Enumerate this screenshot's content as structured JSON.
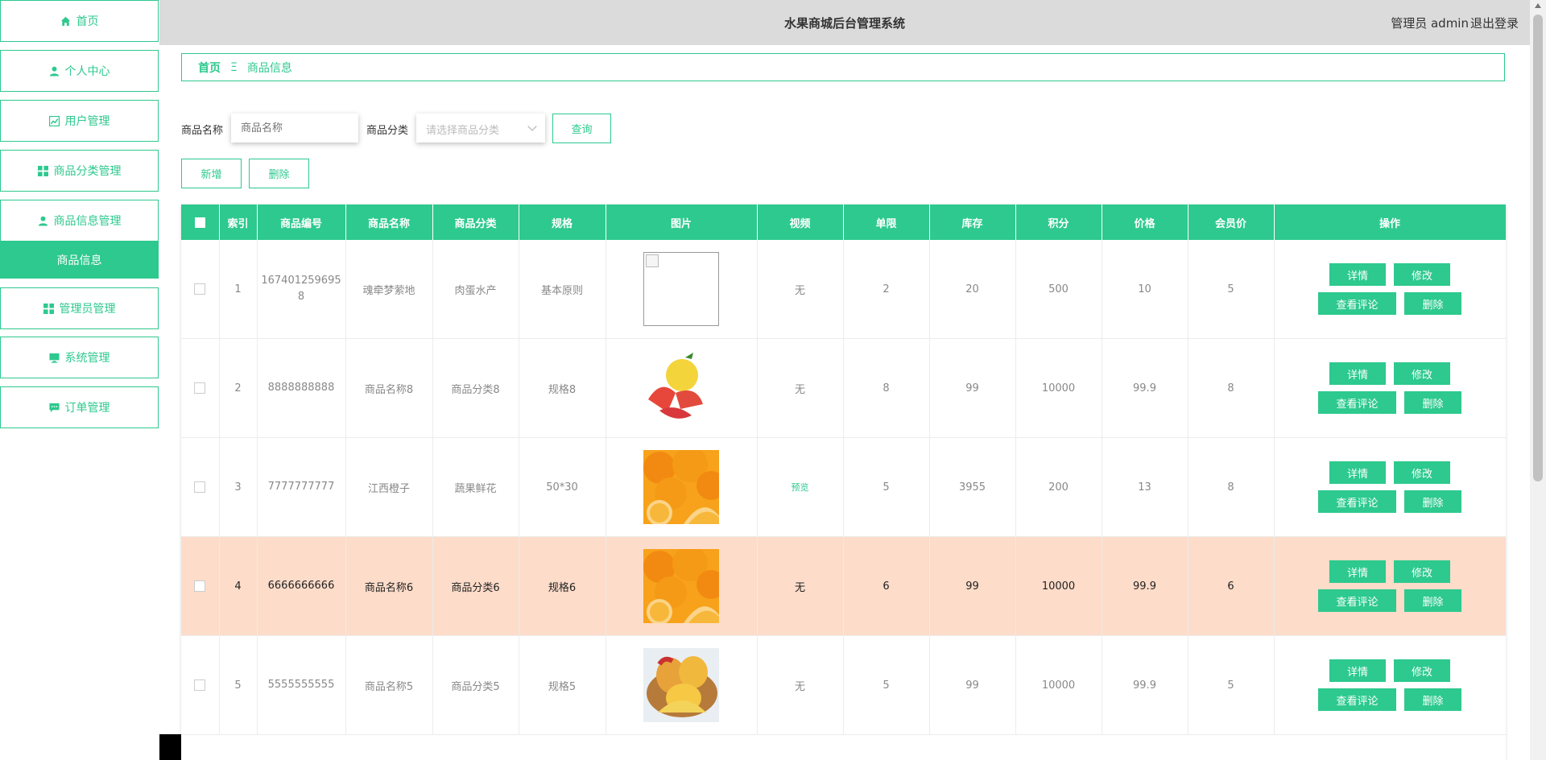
{
  "sidebar": {
    "items": [
      {
        "label": "首页",
        "icon": "home-icon"
      },
      {
        "label": "个人中心",
        "icon": "user-icon"
      },
      {
        "label": "用户管理",
        "icon": "chart-icon"
      },
      {
        "label": "商品分类管理",
        "icon": "grid-icon"
      },
      {
        "label": "商品信息管理",
        "icon": "user-icon"
      },
      {
        "label": "管理员管理",
        "icon": "grid-icon"
      },
      {
        "label": "系统管理",
        "icon": "monitor-icon"
      },
      {
        "label": "订单管理",
        "icon": "chat-icon"
      }
    ],
    "sub_item": "商品信息"
  },
  "header": {
    "title": "水果商城后台管理系统",
    "admin_label": "管理员 admin",
    "logout": "退出登录"
  },
  "breadcrumb": {
    "home": "首页",
    "separator": "Ξ",
    "current": "商品信息"
  },
  "search": {
    "name_label": "商品名称",
    "name_placeholder": "商品名称",
    "category_label": "商品分类",
    "category_placeholder": "请选择商品分类",
    "query_button": "查询"
  },
  "actions": {
    "add": "新增",
    "delete": "删除"
  },
  "table": {
    "headers": [
      "",
      "索引",
      "商品编号",
      "商品名称",
      "商品分类",
      "规格",
      "图片",
      "视频",
      "单限",
      "库存",
      "积分",
      "价格",
      "会员价",
      "操作"
    ],
    "op_labels": {
      "detail": "详情",
      "edit": "修改",
      "comments": "查看评论",
      "delete": "删除"
    },
    "rows": [
      {
        "index": "1",
        "code": "1674012596958",
        "name": "魂牵梦萦地",
        "category": "肉蛋水产",
        "spec": "基本原则",
        "image": "broken",
        "video": "无",
        "limit": "2",
        "stock": "20",
        "points": "500",
        "price": "10",
        "member_price": "5"
      },
      {
        "index": "2",
        "code": "8888888888",
        "name": "商品名称8",
        "category": "商品分类8",
        "spec": "规格8",
        "image": "grapefruit",
        "video": "无",
        "limit": "8",
        "stock": "99",
        "points": "10000",
        "price": "99.9",
        "member_price": "8"
      },
      {
        "index": "3",
        "code": "7777777777",
        "name": "江西橙子",
        "category": "蔬果鲜花",
        "spec": "50*30",
        "image": "orange",
        "video": "预览",
        "limit": "5",
        "stock": "3955",
        "points": "200",
        "price": "13",
        "member_price": "8"
      },
      {
        "index": "4",
        "code": "6666666666",
        "name": "商品名称6",
        "category": "商品分类6",
        "spec": "规格6",
        "image": "orange",
        "video": "无",
        "limit": "6",
        "stock": "99",
        "points": "10000",
        "price": "99.9",
        "member_price": "6"
      },
      {
        "index": "5",
        "code": "5555555555",
        "name": "商品名称5",
        "category": "商品分类5",
        "spec": "规格5",
        "image": "mango",
        "video": "无",
        "limit": "5",
        "stock": "99",
        "points": "10000",
        "price": "99.9",
        "member_price": "5"
      }
    ],
    "highlight_row": 3
  },
  "colors": {
    "accent": "#2dc98e",
    "highlight_row": "#fddcc9",
    "header_bg": "#dcdbdc"
  }
}
